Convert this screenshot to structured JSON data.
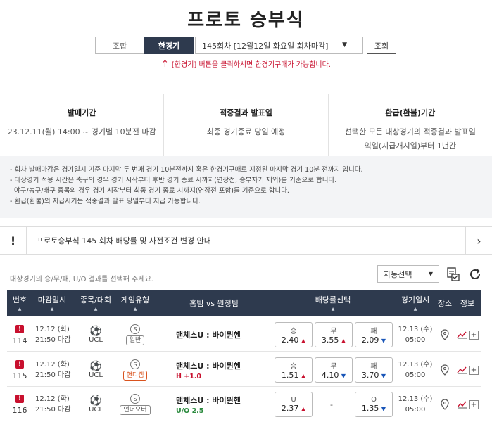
{
  "page": {
    "title": "프로토 승부식"
  },
  "tabs": [
    {
      "label": "조합"
    },
    {
      "label": "한경기"
    }
  ],
  "round_select": {
    "value": "145회차 [12월12일 화요일 회차마감]"
  },
  "lookup_label": "조회",
  "notice": "[한경기] 버튼을 클릭하시면 한경기구매가 가능합니다.",
  "info": [
    {
      "title": "발매기간",
      "lines": [
        "23.12.11(월) 14:00 ~ 경기별 10분전 마감"
      ]
    },
    {
      "title": "적중결과 발표일",
      "lines": [
        "최종 경기종료 당일 예정"
      ]
    },
    {
      "title": "환급(환불)기간",
      "lines": [
        "선택한 모든 대상경기의 적중결과 발표일",
        "익일(지급개시일)부터 1년간"
      ]
    }
  ],
  "notes": [
    "- 회차 발매마감은 경기일시 기준 마지막 두 번째 경기 10분전까지 혹은 한경기구매로 지정된 마지막 경기 10분 전까지 입니다.",
    "- 대상경기 적용 시간은 축구의 경우 경기 시작부터 후반 경기 종료 시까지(연장전, 승부차기 제외)를 기준으로 합니다.",
    "  야구/농구/배구 종목의 경우 경기 시작부터 최종 경기 종료 시까지(연장전 포함)를 기준으로 합니다.",
    "- 환급(환불)의 지급시기는 적중결과 발표 당일부터 지급 가능합니다."
  ],
  "banner": {
    "icon": "!",
    "text": "프로토승부식 145 회차 배당률 및 사전조건 변경 안내"
  },
  "guide": "대상경기의 승/무/패, U/O 결과를 선택해 주세요.",
  "auto_select": "자동선택",
  "table": {
    "headers": [
      "번호",
      "마감일시",
      "종목/대회",
      "게임유형",
      "홈팀 vs 원정팀",
      "배당률선택",
      "경기일시",
      "장소",
      "정보"
    ],
    "rows": [
      {
        "no": "114",
        "close_date": "12.12 (화)",
        "close_time": "21:50 마감",
        "league": "UCL",
        "type": "일반",
        "type_kind": "normal",
        "match": "맨체스U : 바이뮌헨",
        "sub": "",
        "sub_kind": "",
        "odds": [
          {
            "label": "승",
            "value": "2.40",
            "dir": "up"
          },
          {
            "label": "무",
            "value": "3.55",
            "dir": "up"
          },
          {
            "label": "패",
            "value": "2.09",
            "dir": "down"
          }
        ],
        "game_date": "12.13 (수)",
        "game_time": "05:00"
      },
      {
        "no": "115",
        "close_date": "12.12 (화)",
        "close_time": "21:50 마감",
        "league": "UCL",
        "type": "핸디캡",
        "type_kind": "hc",
        "match": "맨체스U : 바이뮌헨",
        "sub": "H +1.0",
        "sub_kind": "h",
        "odds": [
          {
            "label": "승",
            "value": "1.51",
            "dir": "up"
          },
          {
            "label": "무",
            "value": "4.10",
            "dir": "down"
          },
          {
            "label": "패",
            "value": "3.70",
            "dir": "down"
          }
        ],
        "game_date": "12.13 (수)",
        "game_time": "05:00"
      },
      {
        "no": "116",
        "close_date": "12.12 (화)",
        "close_time": "21:50 마감",
        "league": "UCL",
        "type": "언더오버",
        "type_kind": "uo",
        "match": "맨체스U : 바이뮌헨",
        "sub": "U/O 2.5",
        "sub_kind": "uo",
        "odds": [
          {
            "label": "U",
            "value": "2.37",
            "dir": "up"
          },
          {
            "label": "-",
            "value": "",
            "dir": ""
          },
          {
            "label": "O",
            "value": "1.35",
            "dir": "down"
          }
        ],
        "game_date": "12.13 (수)",
        "game_time": "05:00"
      }
    ]
  },
  "colors": {
    "header_bg": "#2e3a4e",
    "accent_red": "#c8102e",
    "down_blue": "#1a56b8"
  }
}
